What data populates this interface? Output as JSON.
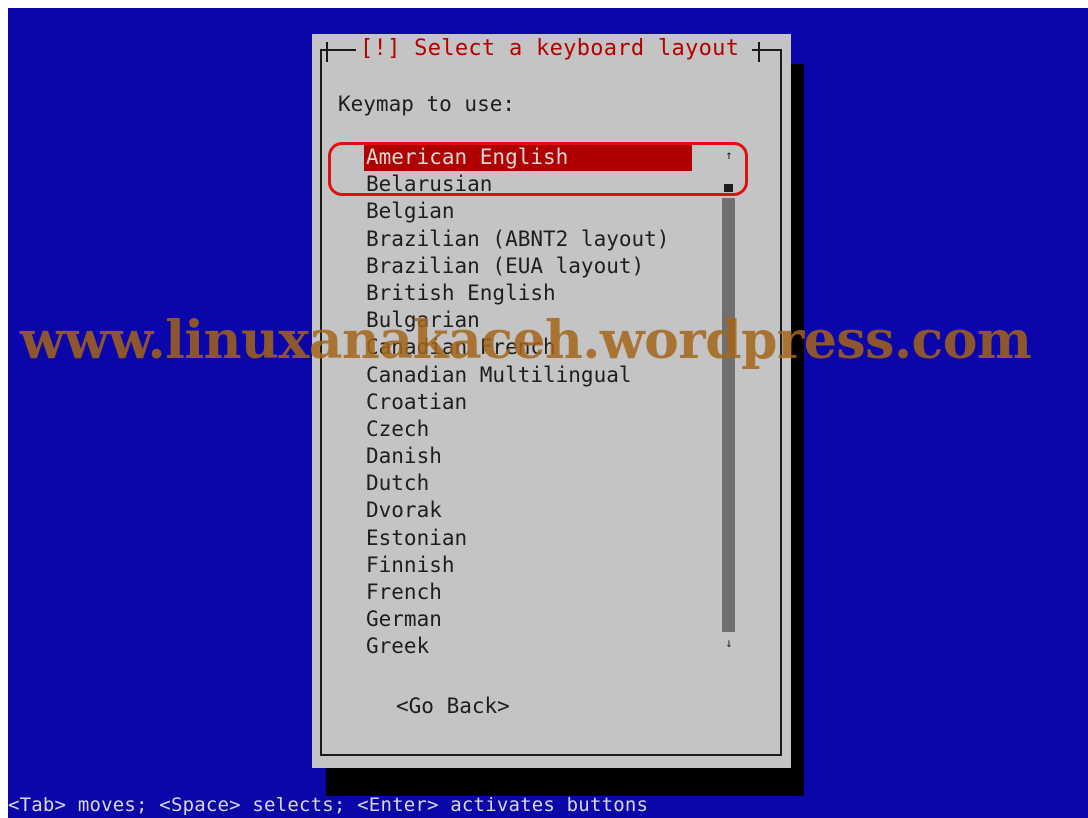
{
  "dialog": {
    "title": "[!] Select a keyboard layout",
    "prompt": "Keymap to use:",
    "items": [
      "American English",
      "Belarusian",
      "Belgian",
      "Brazilian (ABNT2 layout)",
      "Brazilian (EUA layout)",
      "British English",
      "Bulgarian",
      "Canadian French",
      "Canadian Multilingual",
      "Croatian",
      "Czech",
      "Danish",
      "Dutch",
      "Dvorak",
      "Estonian",
      "Finnish",
      "French",
      "German",
      "Greek"
    ],
    "selected_index": 0,
    "go_back_label": "<Go Back>",
    "scroll_up_glyph": "↑",
    "scroll_down_glyph": "↓"
  },
  "status_bar": "<Tab> moves; <Space> selects; <Enter> activates buttons",
  "watermark": "www.linuxanakaceh.wordpress.com",
  "colors": {
    "background": "#0b06a9",
    "dialog": "#c4c4c4",
    "selection": "#b00000",
    "title": "#b40000",
    "watermark": "#a5651a",
    "annotation_ring": "#e01010"
  }
}
